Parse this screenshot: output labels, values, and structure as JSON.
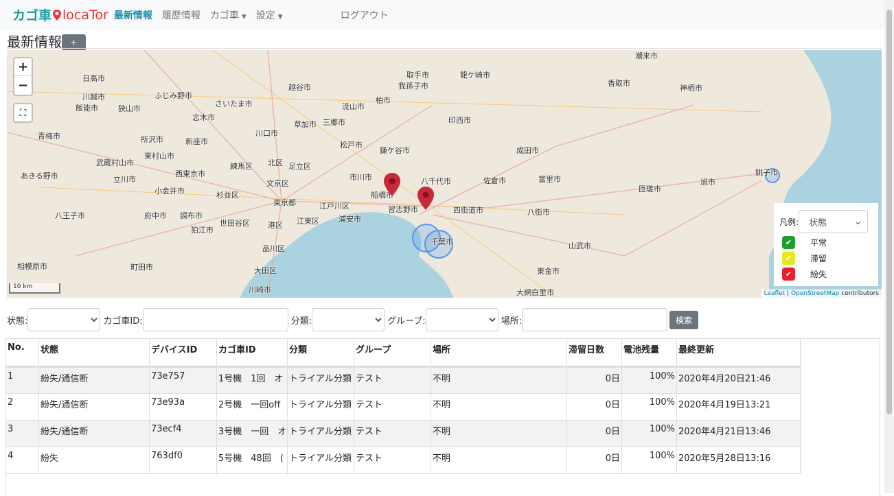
{
  "nav": {
    "logo_left": "カゴ車",
    "logo_right": "locaTor",
    "items": [
      {
        "label": "最新情報",
        "active": true
      },
      {
        "label": "履歴情報"
      },
      {
        "label": "カゴ車",
        "dropdown": true
      },
      {
        "label": "設定",
        "dropdown": true
      }
    ],
    "logout": "ログアウト"
  },
  "page": {
    "title": "最新情報",
    "add_button": "+"
  },
  "map": {
    "zoom_in": "+",
    "zoom_out": "−",
    "fullscreen": "⛶",
    "scale": "10 km",
    "attribution_leaflet": "Leaflet",
    "attribution_sep": " | ",
    "attribution_osm": "OpenStreetMap",
    "attribution_rest": " contributors",
    "places": [
      "日高市",
      "川越市",
      "ふじみ野市",
      "さいたま市",
      "越谷市",
      "流山市",
      "柏市",
      "取手市",
      "龍ケ崎市",
      "潮来市",
      "飯能市",
      "狭山市",
      "志木市",
      "草加市",
      "三郷市",
      "我孫子市",
      "印西市",
      "香取市",
      "神栖市",
      "青梅市",
      "所沢市",
      "新座市",
      "川口市",
      "松戸市",
      "鎌ケ谷市",
      "成田市",
      "武蔵村山市",
      "東村山市",
      "足立区",
      "練馬区",
      "北区",
      "市川市",
      "八千代市",
      "佐倉市",
      "富里市",
      "あきる野市",
      "立川市",
      "西東京市",
      "文京区",
      "船橋市",
      "小金井市",
      "杉並区",
      "東京都",
      "江戸川区",
      "習志野市",
      "四街道市",
      "八街市",
      "匝瑳市",
      "旭市",
      "銚子市",
      "八王子市",
      "府中市",
      "調布市",
      "世田谷区",
      "港区",
      "江東区",
      "浦安市",
      "千葉市",
      "狛江市",
      "品川区",
      "山武市",
      "相模原市",
      "町田市",
      "大田区",
      "東金市",
      "川崎市",
      "大網白里市"
    ],
    "legend": {
      "label": "凡例:",
      "select": "状態",
      "items": [
        {
          "label": "平常",
          "color": "#1e9e2a"
        },
        {
          "label": "滞留",
          "color": "#e8e81a"
        },
        {
          "label": "紛失",
          "color": "#e8202a"
        }
      ]
    }
  },
  "filters": {
    "status_label": "状態:",
    "cart_id_label": "カゴ車ID:",
    "category_label": "分類:",
    "group_label": "グループ:",
    "place_label": "場所:",
    "search_button": "検索",
    "status_value": "",
    "cart_id_value": "",
    "category_value": "",
    "group_value": "",
    "place_value": ""
  },
  "table": {
    "headers": [
      "No.",
      "状態",
      "デバイスID",
      "カゴ車ID",
      "分類",
      "グループ",
      "場所",
      "滞留日数",
      "電池残量",
      "最終更新"
    ],
    "rows": [
      [
        "1",
        "紛失/通信断",
        "73e757",
        "1号機　1回　オ",
        "トライアル分類",
        "テスト",
        "不明",
        "0日",
        "100%",
        "2020年4月20日21:46"
      ],
      [
        "2",
        "紛失/通信断",
        "73e93a",
        "2号機　一回off",
        "トライアル分類",
        "テスト",
        "不明",
        "0日",
        "100%",
        "2020年4月19日13:21"
      ],
      [
        "3",
        "紛失/通信断",
        "73ecf4",
        "3号機　一回　オ",
        "トライアル分類",
        "テスト",
        "不明",
        "0日",
        "100%",
        "2020年4月21日13:46"
      ],
      [
        "4",
        "紛失",
        "763df0",
        "5号機　48回　(",
        "トライアル分類",
        "テスト",
        "不明",
        "0日",
        "100%",
        "2020年5月28日13:16"
      ]
    ]
  }
}
